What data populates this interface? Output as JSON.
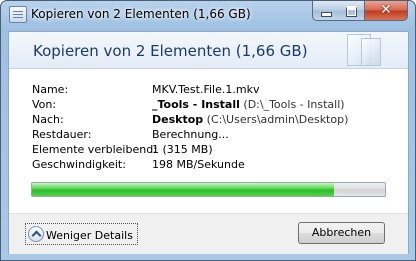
{
  "window": {
    "title": "Kopieren von 2 Elementen (1,66 GB)",
    "close_glyph": "✕"
  },
  "header": {
    "title": "Kopieren von 2 Elementen (1,66 GB)"
  },
  "details": {
    "name_label": "Name:",
    "name_value": "MKV.Test.File.1.mkv",
    "from_label": "Von:",
    "from_bold": "_Tools - Install",
    "from_path": " (D:\\_Tools - Install)",
    "to_label": "Nach:",
    "to_bold": "Desktop",
    "to_path": " (C:\\Users\\admin\\Desktop)",
    "remaining_label": "Restdauer:",
    "remaining_value": "Berechnung...",
    "items_label": "Elemente verbleibend:",
    "items_value": "1 (315 MB)",
    "speed_label": "Geschwindigkeit:",
    "speed_value": "198 MB/Sekunde"
  },
  "progress": {
    "fraction": 0.855,
    "color": "#2bbd28"
  },
  "footer": {
    "details_toggle_label": "Weniger Details",
    "cancel_label": "Abbrechen"
  },
  "icons": [
    "window-icon",
    "minimize-icon",
    "maximize-icon",
    "close-icon",
    "chevron-up-icon"
  ]
}
